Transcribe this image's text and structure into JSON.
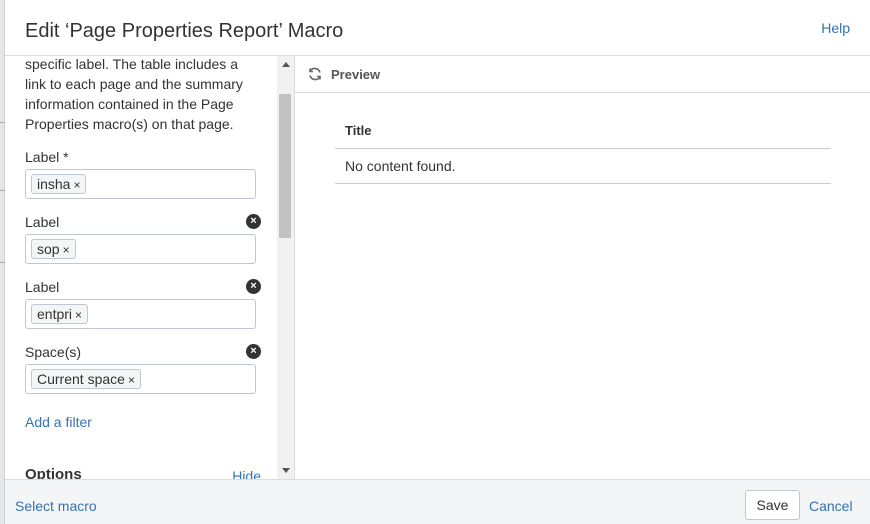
{
  "dialog": {
    "title": "Edit ‘Page Properties Report’ Macro",
    "help_label": "Help"
  },
  "left": {
    "description": "specific label. The table includes a link to each page and the summary information contained in the Page Properties macro(s) on that page.",
    "fields": [
      {
        "label": "Label *",
        "chip": "insha",
        "removable": false
      },
      {
        "label": "Label",
        "chip": "sop",
        "removable": true
      },
      {
        "label": "Label",
        "chip": "entpri",
        "removable": true
      },
      {
        "label": "Space(s)",
        "chip": "Current space",
        "removable": true
      }
    ],
    "chip_remove_glyph": "×",
    "clear_glyph": "×",
    "add_filter_label": "Add a filter",
    "options_title": "Options",
    "hide_label": "Hide"
  },
  "preview": {
    "label": "Preview",
    "table_header": "Title",
    "empty_message": "No content found."
  },
  "footer": {
    "select_macro_label": "Select macro",
    "save_label": "Save",
    "cancel_label": "Cancel"
  },
  "colors": {
    "link": "#3572b0",
    "text": "#333333",
    "border": "#c1c7d0"
  }
}
